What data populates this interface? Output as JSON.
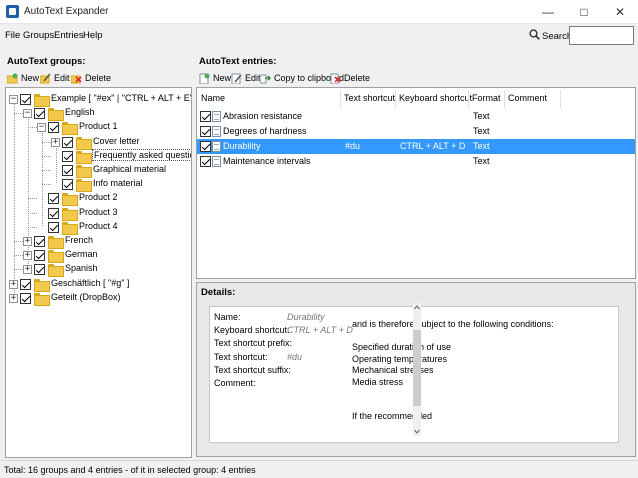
{
  "window": {
    "title": "AutoText Expander",
    "minimize": "—",
    "maximize": "□",
    "close": "✕"
  },
  "menu": [
    "File",
    "Groups",
    "Entries",
    "Help"
  ],
  "search": {
    "label": "Search:",
    "value": "",
    "icon": "search-icon"
  },
  "groups_panel": {
    "label": "AutoText groups:",
    "toolbar": {
      "new": "New",
      "edit": "Edit",
      "delete": "Delete"
    },
    "tree": [
      {
        "label": "Example [ \"#ex\" | \"CTRL + ALT + E\" ]",
        "level": 0,
        "expander": "−",
        "checked": true,
        "icon": "folder-icon"
      },
      {
        "label": "English",
        "level": 1,
        "expander": "−",
        "checked": true,
        "icon": "folder-icon"
      },
      {
        "label": "Product 1",
        "level": 2,
        "expander": "−",
        "checked": true,
        "icon": "folder-icon"
      },
      {
        "label": "Cover letter",
        "level": 3,
        "expander": "+",
        "checked": true,
        "icon": "folder-icon"
      },
      {
        "label": "Frequently asked questions",
        "level": 3,
        "expander": "",
        "checked": true,
        "icon": "folder-icon",
        "selected": true
      },
      {
        "label": "Graphical material",
        "level": 3,
        "expander": "",
        "checked": true,
        "icon": "folder-icon"
      },
      {
        "label": "Info material",
        "level": 3,
        "expander": "",
        "checked": true,
        "icon": "folder-icon"
      },
      {
        "label": "Product 2",
        "level": 2,
        "expander": "",
        "checked": true,
        "icon": "folder-icon"
      },
      {
        "label": "Product 3",
        "level": 2,
        "expander": "",
        "checked": true,
        "icon": "folder-icon"
      },
      {
        "label": "Product 4",
        "level": 2,
        "expander": "",
        "checked": true,
        "icon": "folder-icon"
      },
      {
        "label": "French",
        "level": 1,
        "expander": "+",
        "checked": true,
        "icon": "folder-icon"
      },
      {
        "label": "German",
        "level": 1,
        "expander": "+",
        "checked": true,
        "icon": "folder-icon"
      },
      {
        "label": "Spanish",
        "level": 1,
        "expander": "+",
        "checked": true,
        "icon": "folder-icon"
      },
      {
        "label": "Geschäftlich [ \"#g\" ]",
        "level": 0,
        "expander": "+",
        "checked": true,
        "icon": "folder-icon"
      },
      {
        "label": "Geteilt (DropBox)",
        "level": 0,
        "expander": "+",
        "checked": true,
        "icon": "shared-folder-icon"
      }
    ]
  },
  "entries_panel": {
    "label": "AutoText entries:",
    "toolbar": {
      "new": "New",
      "edit": "Edit",
      "copy": "Copy to clipboard",
      "delete": "Delete"
    },
    "columns": [
      "Name",
      "Text shortcut",
      "Keyboard shortcut",
      "Format",
      "Comment"
    ],
    "rows": [
      {
        "checked": true,
        "name": "Abrasion resistance",
        "text_shortcut": "",
        "keyboard_shortcut": "",
        "format": "Text",
        "comment": ""
      },
      {
        "checked": true,
        "name": "Degrees of hardness",
        "text_shortcut": "",
        "keyboard_shortcut": "",
        "format": "Text",
        "comment": ""
      },
      {
        "checked": true,
        "name": "Durability",
        "text_shortcut": "#du",
        "keyboard_shortcut": "CTRL + ALT + D",
        "format": "Text",
        "comment": "",
        "selected": true
      },
      {
        "checked": true,
        "name": "Maintenance intervals",
        "text_shortcut": "",
        "keyboard_shortcut": "",
        "format": "Text",
        "comment": ""
      }
    ]
  },
  "details": {
    "label": "Details:",
    "fields": [
      {
        "label": "Name:",
        "value": "Durability"
      },
      {
        "label": "Keyboard shortcut:",
        "value": "CTRL + ALT + D"
      },
      {
        "label": "Text shortcut prefix:",
        "value": ""
      },
      {
        "label": "Text shortcut:",
        "value": "#du"
      },
      {
        "label": "Text shortcut suffix:",
        "value": ""
      },
      {
        "label": "Comment:",
        "value": ""
      }
    ],
    "text_lines": [
      "and is therefore subject to the following conditions:",
      "",
      "Specified duration of use",
      "Operating temperatures",
      "Mechanical stresses",
      "Media stress",
      "",
      "",
      "If the recommended"
    ]
  },
  "status": "Total: 16 groups and 4 entries - of it in selected group: 4 entries"
}
